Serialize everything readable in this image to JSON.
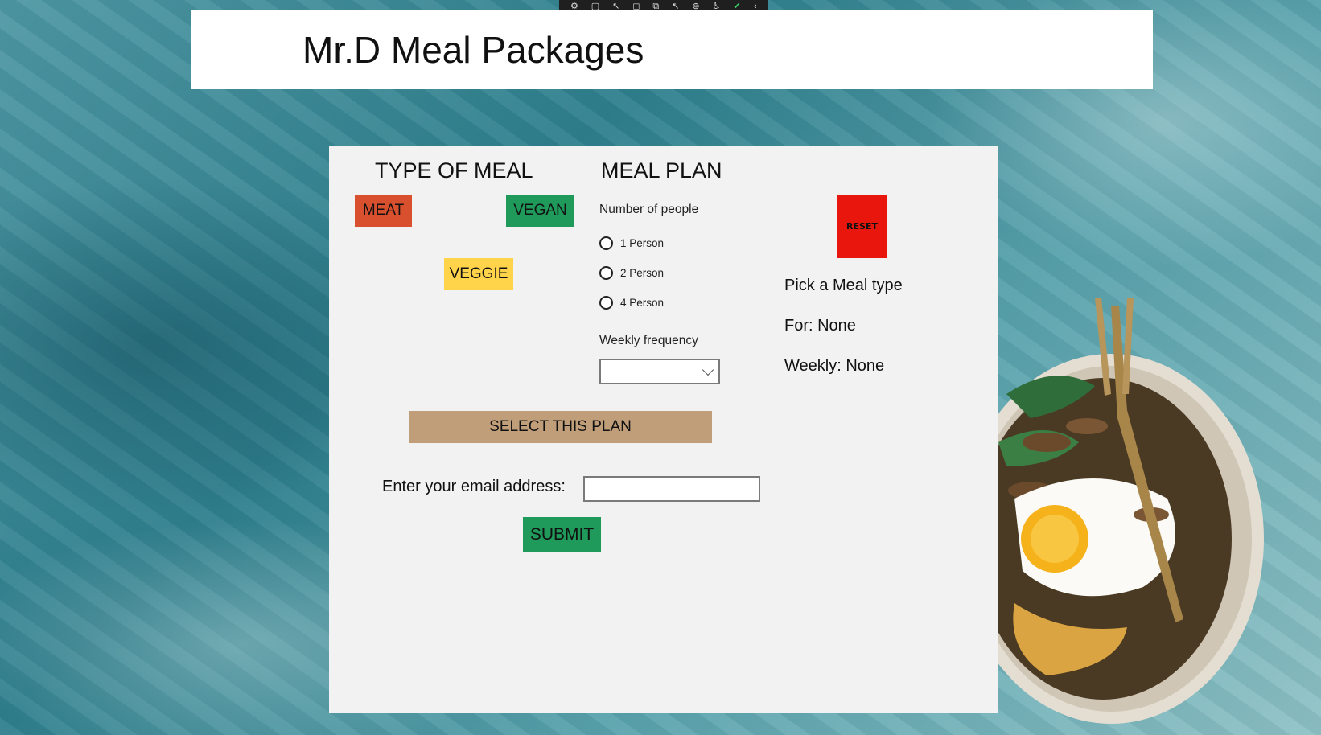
{
  "toolbar": {
    "icons": [
      "live-visual-tree-icon",
      "select-element-icon",
      "display-layout-adorners-icon",
      "track-focus-icon",
      "binding-failures-icon",
      "hot-reload-icon",
      "scan-accessibility-icon",
      "accessibility-icon",
      "hot-reload-status-icon",
      "collapse-toolbar-icon"
    ]
  },
  "header": {
    "title": "Mr.D Meal Packages"
  },
  "meal_type": {
    "heading": "TYPE OF MEAL",
    "buttons": [
      {
        "label": "MEAT",
        "color": "#d9502f"
      },
      {
        "label": "VEGAN",
        "color": "#1f9a5a"
      },
      {
        "label": "VEGGIE",
        "color": "#ffd34a"
      }
    ]
  },
  "meal_plan": {
    "heading": "MEAL PLAN",
    "people_label": "Number of people",
    "people_options": [
      "1 Person",
      "2 Person",
      "4 Person"
    ],
    "frequency_label": "Weekly frequency",
    "frequency_value": ""
  },
  "actions": {
    "reset_label": "RESET",
    "reset_color": "#e8160c",
    "select_plan_label": "SELECT THIS PLAN",
    "select_plan_color": "#c19e7a",
    "submit_label": "SUBMIT",
    "submit_color": "#1f9a5a"
  },
  "summary": {
    "meal_type_text": "Pick a Meal type",
    "for_text": "For: None",
    "weekly_text": "Weekly: None"
  },
  "email": {
    "label": "Enter your email address:",
    "value": ""
  },
  "colors": {
    "panel": "#f2f2f2",
    "header": "#ffffff",
    "background": "#3e8b98"
  }
}
